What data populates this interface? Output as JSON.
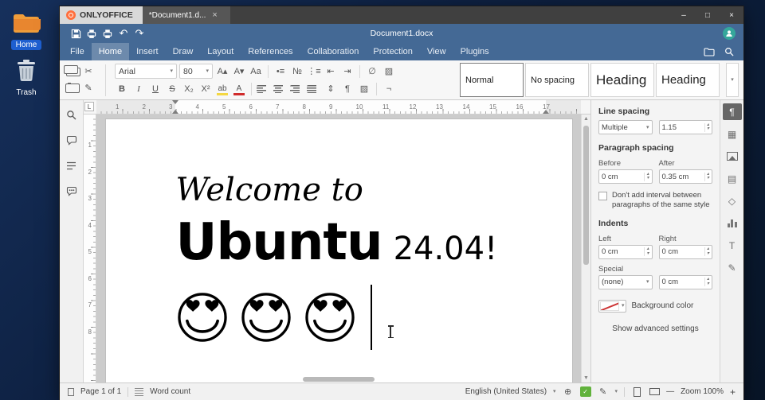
{
  "ui": {
    "chevron": "▾",
    "spin_up": "▴",
    "spin_down": "▾"
  },
  "desktop": {
    "home_label": "Home",
    "trash_label": "Trash"
  },
  "titlebar": {
    "app_name": "ONLYOFFICE",
    "tab_title": "*Document1.d...",
    "tab_close": "×",
    "minimize": "–",
    "maximize": "□",
    "close": "×"
  },
  "header": {
    "doc_title": "Document1.docx",
    "undo": "↶",
    "redo": "↷",
    "user_initial": ""
  },
  "menu": {
    "items": [
      "File",
      "Home",
      "Insert",
      "Draw",
      "Layout",
      "References",
      "Collaboration",
      "Protection",
      "View",
      "Plugins"
    ],
    "active": "Home"
  },
  "toolbar": {
    "font_name": "Arial",
    "font_size": "80",
    "clipboard": [
      {
        "name": "copy-icon",
        "cls": "i-copy"
      },
      {
        "name": "cut-icon",
        "glyph": "✂"
      },
      {
        "name": "paste-icon",
        "cls": "i-paste"
      },
      {
        "name": "format-painter-icon",
        "glyph": "✎"
      }
    ],
    "row1": [
      {
        "name": "increment-font-icon",
        "glyph": "A▴"
      },
      {
        "name": "decrement-font-icon",
        "glyph": "A▾"
      },
      {
        "name": "change-case-icon",
        "glyph": "Aa"
      },
      {
        "sep": true
      },
      {
        "name": "bullets-icon",
        "glyph": "•≡"
      },
      {
        "name": "numbering-icon",
        "glyph": "№"
      },
      {
        "name": "multilevel-list-icon",
        "glyph": "⋮≡"
      },
      {
        "name": "decrease-indent-icon",
        "glyph": "⇤"
      },
      {
        "name": "increase-indent-icon",
        "glyph": "⇥"
      },
      {
        "sep": true
      },
      {
        "name": "clear-style-icon",
        "glyph": "∅"
      },
      {
        "name": "color-scheme-icon",
        "glyph": "▨"
      }
    ],
    "row2": [
      {
        "name": "bold-icon",
        "glyph": "B",
        "cls": "fw"
      },
      {
        "name": "italic-icon",
        "glyph": "I",
        "cls": "it"
      },
      {
        "name": "underline-icon",
        "glyph": "U",
        "cls": "un"
      },
      {
        "name": "strikeout-icon",
        "glyph": "S",
        "cls": "st"
      },
      {
        "name": "subscript-icon",
        "glyph": "X₂"
      },
      {
        "name": "superscript-icon",
        "glyph": "X²"
      },
      {
        "name": "highlight-color-icon",
        "glyph": "ab",
        "cls": "i-hl"
      },
      {
        "name": "font-color-icon",
        "glyph": "A",
        "cls": "i-fc"
      },
      {
        "sep": true
      },
      {
        "name": "align-left-icon",
        "cls": "ia ia-l"
      },
      {
        "name": "align-center-icon",
        "cls": "ia ia-c"
      },
      {
        "name": "align-right-icon",
        "cls": "ia ia-r"
      },
      {
        "name": "align-justify-icon",
        "cls": "ia ia-j"
      },
      {
        "name": "line-spacing-icon",
        "glyph": "⇕"
      },
      {
        "name": "paragraph-marks-icon",
        "glyph": "¶"
      },
      {
        "name": "paragraph-shading-icon",
        "glyph": "▨"
      },
      {
        "sep": true
      },
      {
        "name": "copy-style-icon",
        "glyph": "¬"
      }
    ],
    "styles": [
      {
        "label": "Normal",
        "selected": true,
        "cls": "st-normal"
      },
      {
        "label": "No spacing",
        "cls": "st-nospace"
      },
      {
        "label": "Heading",
        "cls": "st-h1"
      },
      {
        "label": "Heading",
        "cls": "st-h2"
      }
    ]
  },
  "ruler": {
    "tab_selector": "L",
    "h_numbers": [
      "1",
      "2",
      "3",
      "4",
      "5",
      "6",
      "7",
      "8",
      "9",
      "10",
      "11",
      "12",
      "13",
      "14",
      "15",
      "16",
      "17"
    ],
    "v_numbers": [
      "1",
      "2",
      "3",
      "4",
      "5",
      "6",
      "7",
      "8"
    ]
  },
  "document": {
    "line1": "Welcome to",
    "line2_word": "Ubuntu",
    "line2_rest": "24.04!",
    "emoji_count": 3
  },
  "right_strip": [
    {
      "name": "paragraph-settings-icon",
      "glyph": "¶",
      "active": true
    },
    {
      "name": "table-settings-icon",
      "glyph": "▦"
    },
    {
      "name": "image-settings-icon",
      "cls": "i-img"
    },
    {
      "name": "header-footer-settings-icon",
      "glyph": "▤"
    },
    {
      "name": "shape-settings-icon",
      "glyph": "◇"
    },
    {
      "name": "chart-settings-icon",
      "cls": "i-chart"
    },
    {
      "name": "textart-settings-icon",
      "glyph": "T"
    },
    {
      "name": "signature-settings-icon",
      "glyph": "✎"
    }
  ],
  "sidebar": {
    "line_spacing_label": "Line spacing",
    "line_spacing_mode": "Multiple",
    "line_spacing_value": "1.15",
    "paragraph_spacing_label": "Paragraph spacing",
    "before_label": "Before",
    "after_label": "After",
    "before_value": "0 cm",
    "after_value": "0.35 cm",
    "no_interval_label": "Don't add interval between paragraphs of the same style",
    "indents_label": "Indents",
    "left_label": "Left",
    "right_label": "Right",
    "indent_left_value": "0 cm",
    "indent_right_value": "0 cm",
    "special_label": "Special",
    "special_mode": "(none)",
    "special_value": "0 cm",
    "background_color_label": "Background color",
    "advanced_settings_label": "Show advanced settings"
  },
  "statusbar": {
    "page_label": "Page 1 of 1",
    "word_count_label": "Word count",
    "language": "English (United States)",
    "globe_glyph": "⊕",
    "spell_glyph": "✓",
    "track_glyph": "✎",
    "zoom_out": "—",
    "zoom_label": "Zoom 100%",
    "zoom_in": "+"
  }
}
